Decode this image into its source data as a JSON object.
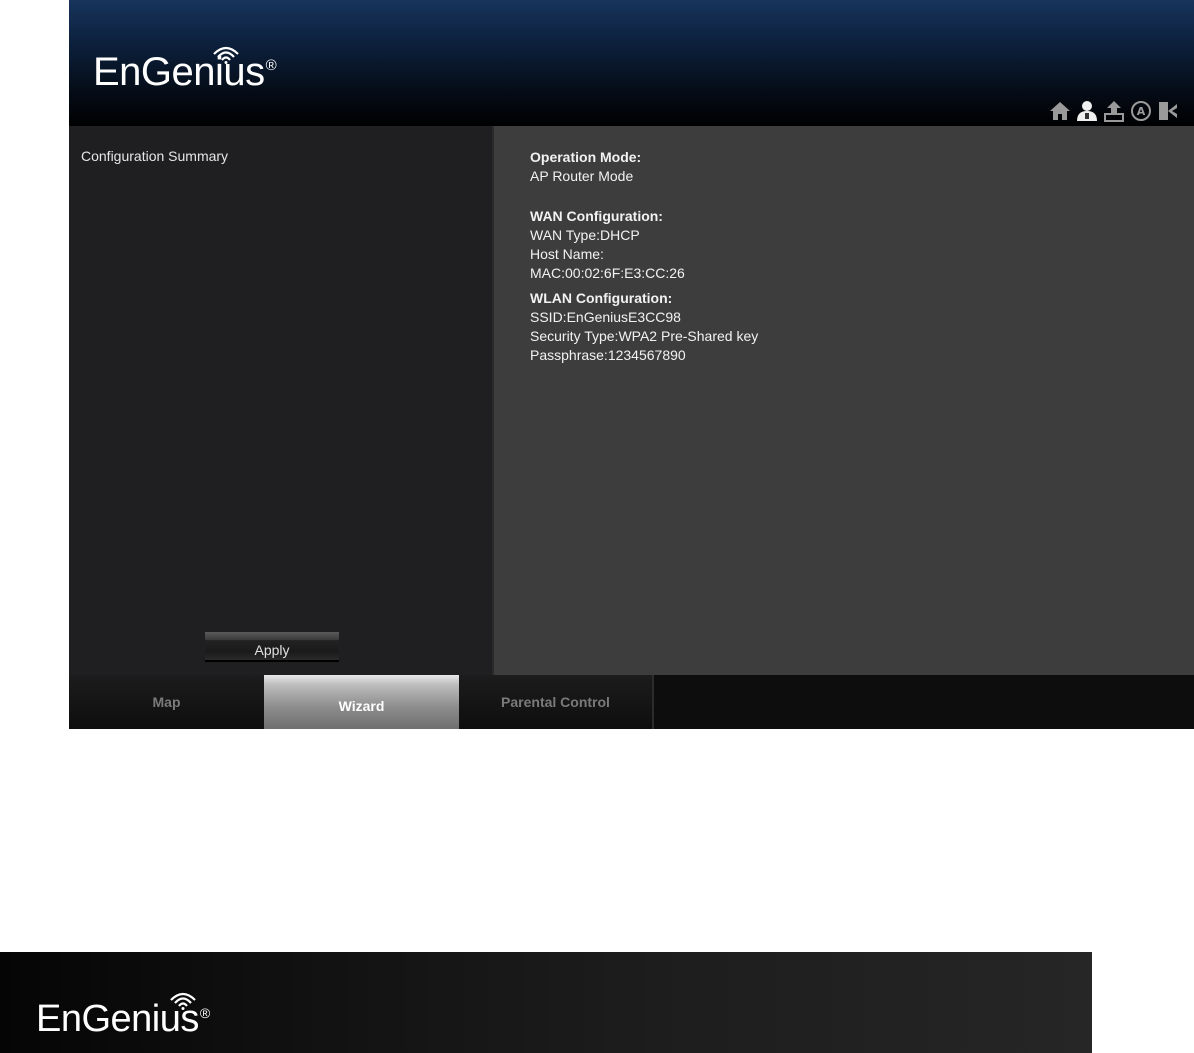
{
  "brand": {
    "name": "EnGenius",
    "registered": "®"
  },
  "header_icons": [
    "home-icon",
    "user-icon",
    "upload-icon",
    "at-icon",
    "logout-icon"
  ],
  "left_panel": {
    "title": "Configuration Summary",
    "apply_label": "Apply"
  },
  "summary": {
    "operation_mode_title": "Operation Mode:",
    "operation_mode_value": "AP Router Mode",
    "wan_title": "WAN Configuration:",
    "wan_type": "WAN Type:DHCP",
    "host_name": "Host Name:",
    "mac": "MAC:00:02:6F:E3:CC:26",
    "wlan_title": "WLAN Configuration:",
    "ssid": "SSID:EnGeniusE3CC98",
    "security_type": "Security Type:WPA2 Pre-Shared key",
    "passphrase": "Passphrase:1234567890"
  },
  "tabs": [
    {
      "label": "Map",
      "active": false
    },
    {
      "label": "Wizard",
      "active": true
    },
    {
      "label": "Parental Control",
      "active": false
    }
  ],
  "colors": {
    "header_top": "#17345c",
    "left_panel_bg": "#1f1f21",
    "right_panel_bg": "#3d3d3e",
    "tab_active": "#bdbdbd"
  }
}
